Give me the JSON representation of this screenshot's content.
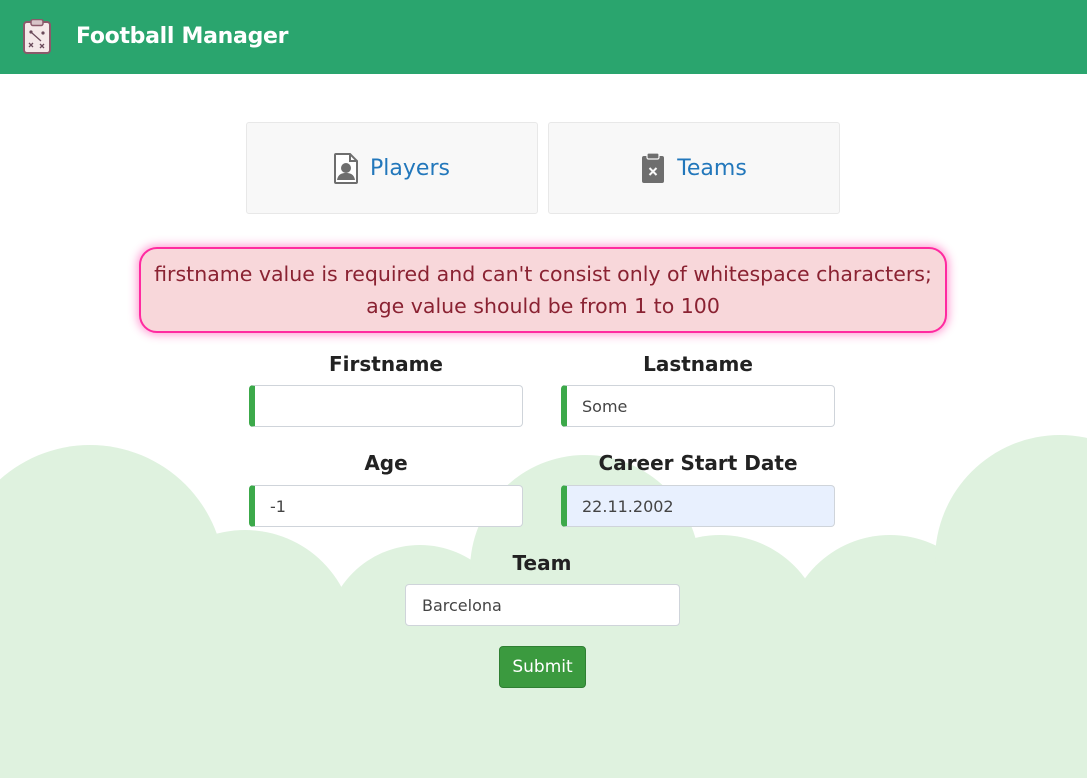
{
  "app": {
    "title": "Football Manager",
    "brand_color": "#2aa56e"
  },
  "nav": {
    "players_label": "Players",
    "teams_label": "Teams",
    "players_icon": "person-file-icon",
    "teams_icon": "clipboard-x-icon"
  },
  "error": {
    "message": "firstname value is required and can't consist only of whitespace characters; age value should be from 1 to 100"
  },
  "form": {
    "firstname": {
      "label": "Firstname",
      "value": ""
    },
    "lastname": {
      "label": "Lastname",
      "value": "Some"
    },
    "age": {
      "label": "Age",
      "value": "-1"
    },
    "career_start": {
      "label": "Career Start Date",
      "value": "22.11.2002"
    },
    "team": {
      "label": "Team",
      "value": "Barcelona"
    },
    "submit_label": "Submit"
  },
  "colors": {
    "error_bg": "#f8d7da",
    "error_border": "#ff2aa0",
    "valid_accent": "#3ca94a",
    "submit": "#3b9a3f",
    "cloud": "#dff2df"
  }
}
